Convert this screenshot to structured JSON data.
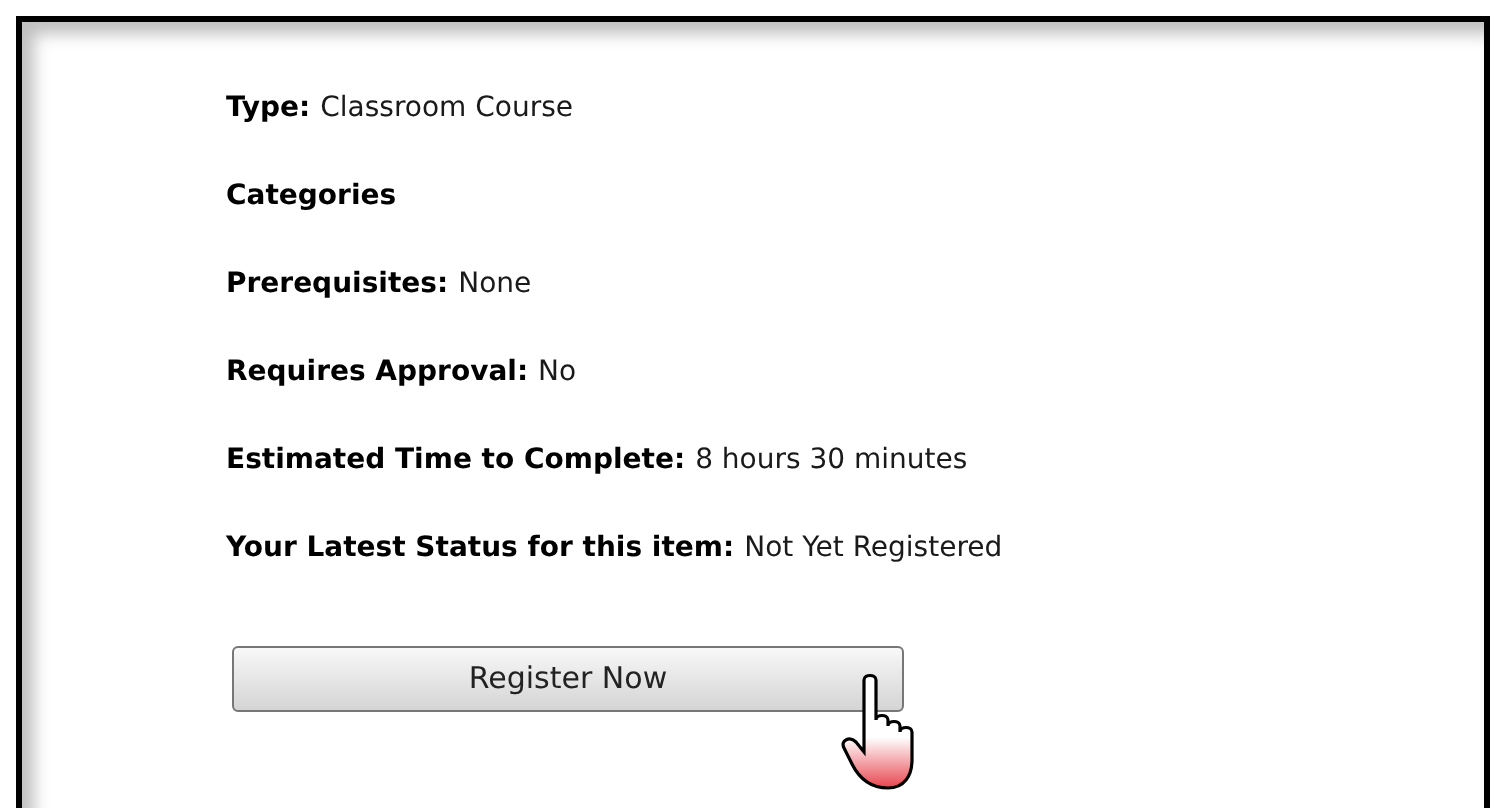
{
  "fields": [
    {
      "label": "Type:",
      "value": "Classroom Course"
    },
    {
      "label": "Categories"
    },
    {
      "label": "Prerequisites:",
      "value": "None"
    },
    {
      "label": "Requires Approval:",
      "value": "No"
    },
    {
      "label": "Estimated Time to Complete:",
      "value": "8 hours 30 minutes"
    },
    {
      "label": "Your Latest Status for this item:",
      "value": "Not Yet Registered"
    }
  ],
  "button": {
    "label": "Register Now"
  }
}
